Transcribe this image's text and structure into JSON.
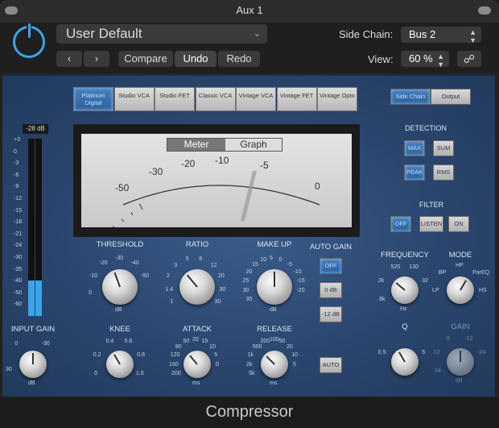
{
  "window": {
    "title": "Aux 1"
  },
  "header": {
    "preset": "User Default",
    "compare": "Compare",
    "undo": "Undo",
    "redo": "Redo",
    "side_chain_label": "Side Chain:",
    "side_chain_value": "Bus 2",
    "view_label": "View:",
    "view_value": "60 %"
  },
  "modes": [
    "Platinum Digital",
    "Studio VCA",
    "Studio FET",
    "Classic VCA",
    "Vintage VCA",
    "Vintage FET",
    "Vintage Opto"
  ],
  "active_mode": "Platinum Digital",
  "output_toggle": {
    "side_chain": "Side Chain",
    "output": "Output",
    "active": "Side Chain"
  },
  "meter": {
    "tabs": [
      "Meter",
      "Graph"
    ],
    "active_tab": "Meter",
    "scale": [
      "-50",
      "-30",
      "-20",
      "-10",
      "-5",
      "0"
    ]
  },
  "input_meter": {
    "readout": "-28 dB",
    "scale": [
      "+3",
      "0",
      "-3",
      "-6",
      "-9",
      "-12",
      "-15",
      "-18",
      "-21",
      "-24",
      "-30",
      "-35",
      "-40",
      "-50",
      "-60"
    ],
    "level": 0.2
  },
  "knobs": {
    "threshold": {
      "label": "THRESHOLD",
      "ticks": [
        "-30",
        "-20",
        "-40",
        "-10",
        "-50",
        "0",
        "dB"
      ]
    },
    "ratio": {
      "label": "RATIO",
      "ticks": [
        "5",
        "8",
        "3",
        "12",
        "2",
        "20",
        "1.4",
        "30",
        "1",
        "30"
      ]
    },
    "makeup": {
      "label": "MAKE UP",
      "ticks": [
        "5",
        "10",
        "0",
        "15",
        "-5",
        "20",
        "-10",
        "25",
        "-15",
        "30",
        "-20",
        "35",
        "dB"
      ]
    },
    "input_gain": {
      "label": "INPUT GAIN",
      "ticks": [
        "0",
        "-30",
        "30",
        "dB"
      ]
    },
    "knee": {
      "label": "KNEE",
      "ticks": [
        "0.4",
        "0.6",
        "0.2",
        "0.8",
        "0",
        "1.0"
      ]
    },
    "attack": {
      "label": "ATTACK",
      "ticks": [
        "20",
        "50",
        "15",
        "80",
        "10",
        "120",
        "5",
        "160",
        "0",
        "200",
        "ms"
      ]
    },
    "release": {
      "label": "RELEASE",
      "ticks": [
        "100",
        "200",
        "50",
        "500",
        "20",
        "1k",
        "10",
        "2k",
        "5",
        "5k",
        "ms"
      ]
    },
    "frequency": {
      "label": "FREQUENCY",
      "ticks": [
        "520",
        "130",
        "2k",
        "32",
        "8k",
        "Hz"
      ]
    },
    "mode": {
      "label": "MODE",
      "ticks": [
        "HP",
        "BP",
        "ParEQ",
        "LP",
        "HS"
      ]
    },
    "q": {
      "label": "Q",
      "ticks": [
        "0.5",
        "5"
      ]
    },
    "gain": {
      "label": "GAIN",
      "ticks": [
        "0",
        "-12",
        "12",
        "-24",
        "24",
        "dB"
      ]
    }
  },
  "auto_gain": {
    "label": "AUTO GAIN",
    "buttons": [
      "OFF",
      "0 dB",
      "-12 dB"
    ],
    "active": "OFF",
    "auto": "AUTO"
  },
  "detection": {
    "label": "DETECTION",
    "buttons": [
      "MAX",
      "SUM",
      "PEAK",
      "RMS"
    ],
    "active": [
      "MAX",
      "PEAK"
    ]
  },
  "filter": {
    "label": "FILTER",
    "buttons": [
      "OFF",
      "LISTEN",
      "ON"
    ],
    "active": "OFF"
  },
  "footer": {
    "title": "Compressor"
  },
  "colors": {
    "accent": "#3aa4e8",
    "panel": "#2b466e",
    "active_button": "#2f5f9c"
  }
}
